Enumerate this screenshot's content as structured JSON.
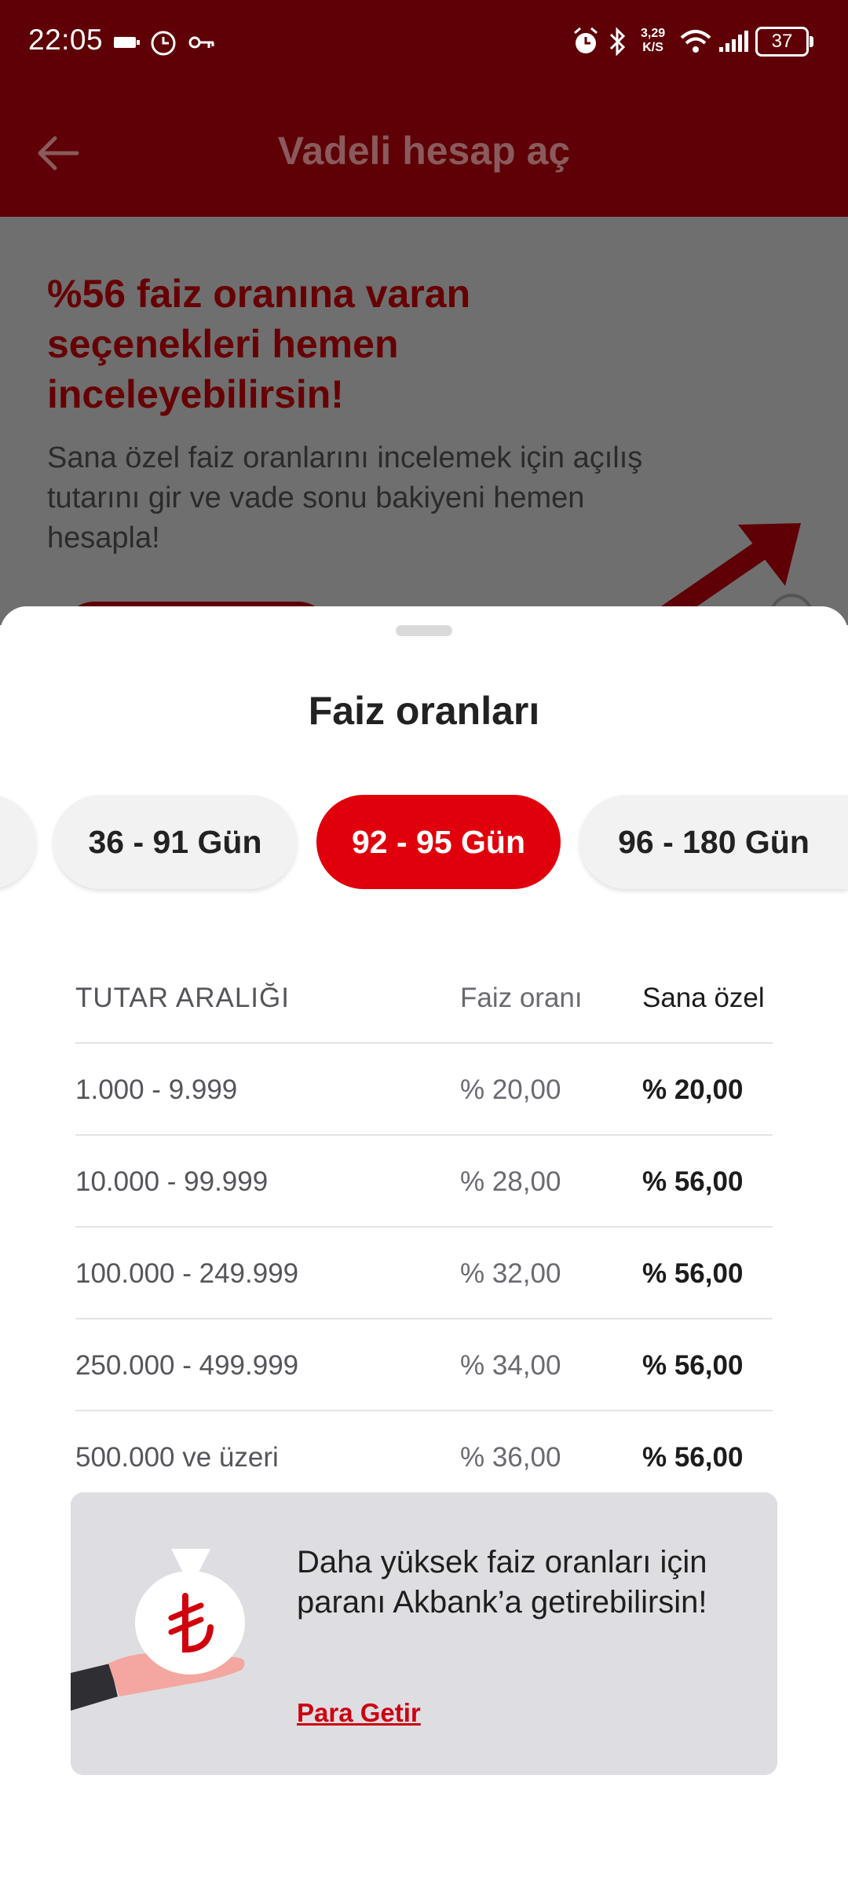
{
  "status_bar": {
    "time": "22:05",
    "net_speed_value": "3,29",
    "net_speed_unit": "K/S",
    "battery": "37",
    "icons": [
      "battery-saver-icon",
      "timer-icon",
      "vpn-key-icon",
      "alarm-icon",
      "bluetooth-icon",
      "wifi-icon",
      "signal-icon"
    ]
  },
  "app_bar": {
    "title": "Vadeli hesap aç",
    "back_icon": "arrow-left-icon"
  },
  "background_promo": {
    "title": "%56 faiz oranına varan seçenekleri hemen inceleyebilirsin!",
    "description": "Sana özel faiz oranlarını incelemek için açılış tutarını gir ve vade sonu bakiyeni hemen hesapla!"
  },
  "sheet": {
    "title": "Faiz oranları",
    "tabs": [
      {
        "label": "36 - 91 Gün",
        "active": false
      },
      {
        "label": "92 - 95 Gün",
        "active": true
      },
      {
        "label": "96 - 180 Gün",
        "active": false
      }
    ],
    "table": {
      "headers": {
        "range": "TUTAR ARALIĞI",
        "rate": "Faiz oranı",
        "special": "Sana özel"
      },
      "rows": [
        {
          "range": "1.000 - 9.999",
          "rate": "% 20,00",
          "special": "% 20,00"
        },
        {
          "range": "10.000 - 99.999",
          "rate": "% 28,00",
          "special": "% 56,00"
        },
        {
          "range": "100.000 - 249.999",
          "rate": "% 32,00",
          "special": "% 56,00"
        },
        {
          "range": "250.000 - 499.999",
          "rate": "% 34,00",
          "special": "% 56,00"
        },
        {
          "range": "500.000 ve üzeri",
          "rate": "% 36,00",
          "special": "% 56,00"
        }
      ]
    },
    "promo_card": {
      "text": "Daha yüksek faiz oranları için paranı Akbank’a getirebilirsin!",
      "link": "Para Getir",
      "illustration": "money-bag-hand-icon"
    }
  },
  "colors": {
    "brand_dark": "#5e0005",
    "accent_red": "#e0000c",
    "link_red": "#cc0010",
    "card_bg": "#dedde2"
  }
}
